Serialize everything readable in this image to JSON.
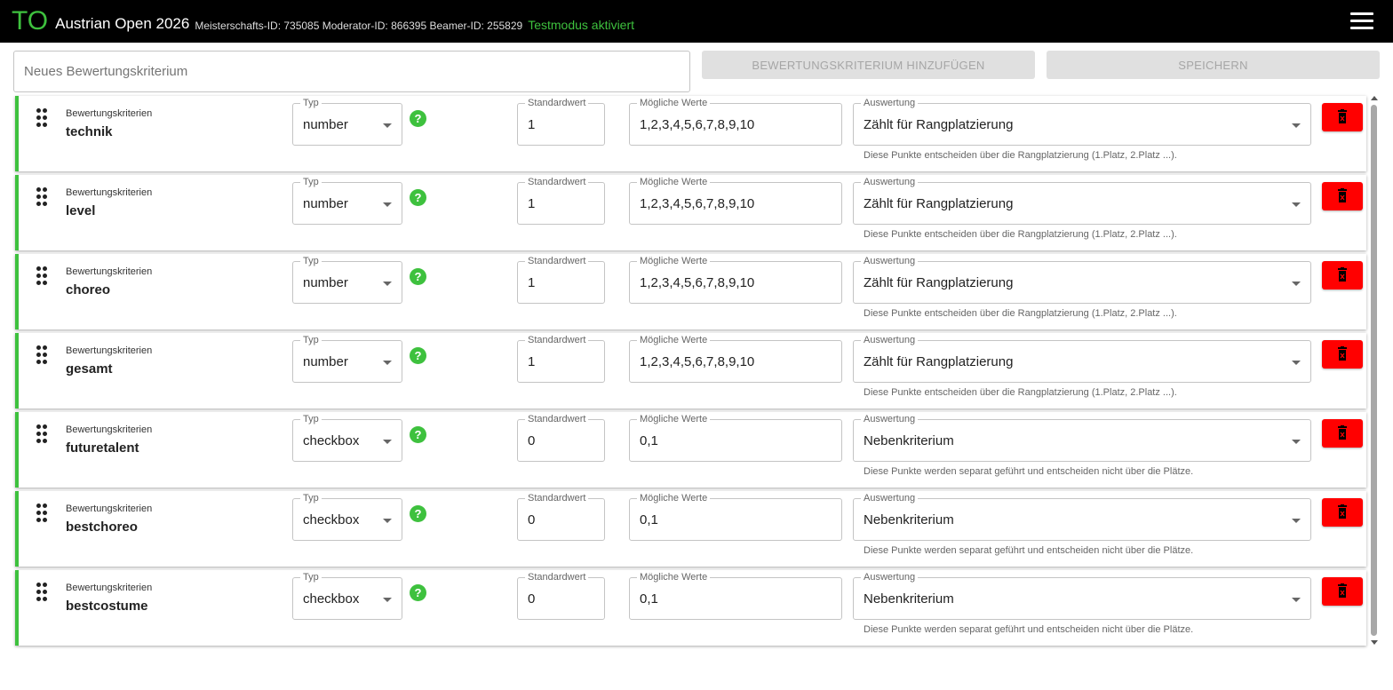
{
  "header": {
    "logo": "TO",
    "title": "Austrian Open 2026",
    "meta": "Meisterschafts-ID: 735085 Moderator-ID: 866395 Beamer-ID: 255829",
    "testmode": "Testmodus aktiviert"
  },
  "toolbar": {
    "new_placeholder": "Neues Bewertungskriterium",
    "add_label": "BEWERTUNGSKRITERIUM HINZUFÜGEN",
    "save_label": "SPEICHERN"
  },
  "labels": {
    "criteria_caption": "Bewertungskriterien",
    "typ": "Typ",
    "standardwert": "Standardwert",
    "moegliche_werte": "Mögliche Werte",
    "auswertung": "Auswertung"
  },
  "criteria": [
    {
      "name": "technik",
      "typ": "number",
      "standardwert": "1",
      "werte": "1,2,3,4,5,6,7,8,9,10",
      "auswertung": "Zählt für Rangplatzierung",
      "hint": "Diese Punkte entscheiden über die Rangplatzierung (1.Platz, 2.Platz ...)."
    },
    {
      "name": "level",
      "typ": "number",
      "standardwert": "1",
      "werte": "1,2,3,4,5,6,7,8,9,10",
      "auswertung": "Zählt für Rangplatzierung",
      "hint": "Diese Punkte entscheiden über die Rangplatzierung (1.Platz, 2.Platz ...)."
    },
    {
      "name": "choreo",
      "typ": "number",
      "standardwert": "1",
      "werte": "1,2,3,4,5,6,7,8,9,10",
      "auswertung": "Zählt für Rangplatzierung",
      "hint": "Diese Punkte entscheiden über die Rangplatzierung (1.Platz, 2.Platz ...)."
    },
    {
      "name": "gesamt",
      "typ": "number",
      "standardwert": "1",
      "werte": "1,2,3,4,5,6,7,8,9,10",
      "auswertung": "Zählt für Rangplatzierung",
      "hint": "Diese Punkte entscheiden über die Rangplatzierung (1.Platz, 2.Platz ...)."
    },
    {
      "name": "futuretalent",
      "typ": "checkbox",
      "standardwert": "0",
      "werte": "0,1",
      "auswertung": "Nebenkriterium",
      "hint": "Diese Punkte werden separat geführt und entscheiden nicht über die Plätze."
    },
    {
      "name": "bestchoreo",
      "typ": "checkbox",
      "standardwert": "0",
      "werte": "0,1",
      "auswertung": "Nebenkriterium",
      "hint": "Diese Punkte werden separat geführt und entscheiden nicht über die Plätze."
    },
    {
      "name": "bestcostume",
      "typ": "checkbox",
      "standardwert": "0",
      "werte": "0,1",
      "auswertung": "Nebenkriterium",
      "hint": "Diese Punkte werden separat geführt und entscheiden nicht über die Plätze."
    }
  ],
  "colors": {
    "accent": "#3ec13e",
    "danger": "#ff0000",
    "topbar": "#000000"
  },
  "icons": {
    "menu": "hamburger-menu-icon",
    "drag": "drag-handle-icon",
    "help": "help-icon",
    "delete": "trash-icon",
    "select": "caret-down-icon"
  }
}
